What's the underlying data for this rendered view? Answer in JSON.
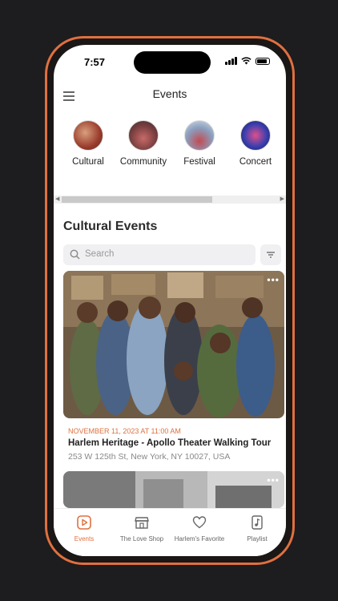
{
  "status": {
    "time": "7:57"
  },
  "header": {
    "title": "Events"
  },
  "categories": [
    {
      "label": "Cultural"
    },
    {
      "label": "Community"
    },
    {
      "label": "Festival"
    },
    {
      "label": "Concert"
    }
  ],
  "section": {
    "title": "Cultural Events"
  },
  "search": {
    "placeholder": "Search"
  },
  "events": [
    {
      "date": "NOVEMBER 11, 2023 AT 11:00 AM",
      "title": "Harlem Heritage - Apollo Theater Walking Tour",
      "address": "253 W 125th St, New York, NY 10027, USA",
      "menu": "•••"
    },
    {
      "menu": "•••"
    }
  ],
  "tabs": [
    {
      "label": "Events",
      "icon": "play-square-icon",
      "active": true
    },
    {
      "label": "The Love Shop",
      "icon": "shop-icon"
    },
    {
      "label": "Harlem's Favorite",
      "icon": "heart-icon"
    },
    {
      "label": "Playlist",
      "icon": "music-file-icon"
    }
  ],
  "colors": {
    "accent": "#e0703f",
    "frame": "#e0703f"
  }
}
